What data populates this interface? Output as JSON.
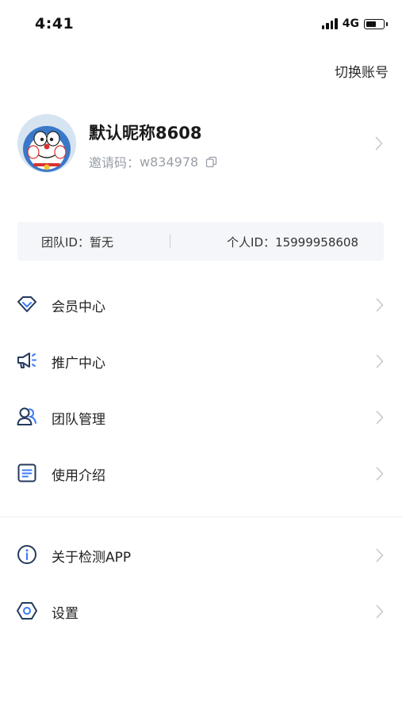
{
  "status_bar": {
    "time": "4:41",
    "network": "4G"
  },
  "header": {
    "switch_account": "切换账号"
  },
  "profile": {
    "nickname": "默认昵称8608",
    "invite_label": "邀请码：",
    "invite_code": "w834978"
  },
  "ids": {
    "team_id": "团队ID：暂无",
    "personal_id": "个人ID：15999958608"
  },
  "menu_group_1": [
    {
      "label": "会员中心",
      "icon": "diamond-icon"
    },
    {
      "label": "推广中心",
      "icon": "megaphone-icon"
    },
    {
      "label": "团队管理",
      "icon": "team-icon"
    },
    {
      "label": "使用介绍",
      "icon": "document-icon"
    }
  ],
  "menu_group_2": [
    {
      "label": "关于检测APP",
      "icon": "info-icon"
    },
    {
      "label": "设置",
      "icon": "settings-icon"
    }
  ],
  "colors": {
    "icon_stroke": "#243a5e",
    "icon_accent": "#3d7bf7",
    "chevron": "#c4c8ce",
    "id_bar_bg": "#f4f6f9"
  }
}
